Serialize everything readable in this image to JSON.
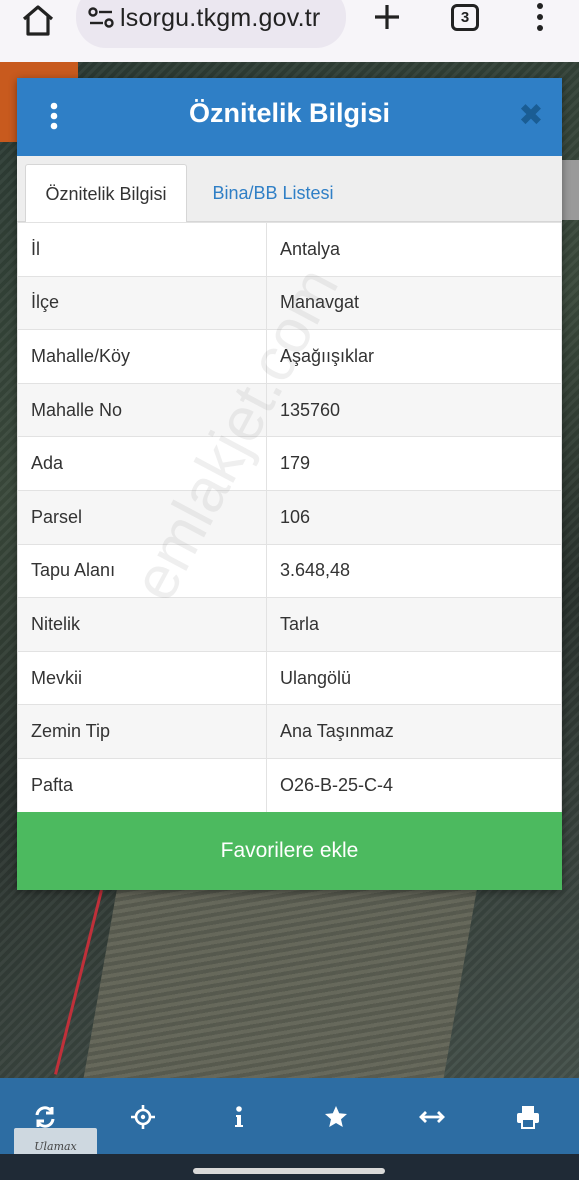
{
  "browser": {
    "url": "lsorgu.tkgm.gov.tr",
    "tab_count": "3",
    "icons": [
      "home-icon",
      "site-info-icon",
      "plus-icon",
      "tab-switcher-icon",
      "more-vertical-icon"
    ]
  },
  "dialog": {
    "title": "Öznitelik Bilgisi",
    "close_glyph": "✖",
    "tabs": [
      {
        "label": "Öznitelik Bilgisi",
        "active": true
      },
      {
        "label": "Bina/BB Listesi",
        "active": false
      }
    ],
    "rows": [
      {
        "key": "İl",
        "value": "Antalya"
      },
      {
        "key": "İlçe",
        "value": "Manavgat"
      },
      {
        "key": "Mahalle/Köy",
        "value": "Aşağıışıklar"
      },
      {
        "key": "Mahalle No",
        "value": "135760"
      },
      {
        "key": "Ada",
        "value": "179"
      },
      {
        "key": "Parsel",
        "value": "106"
      },
      {
        "key": "Tapu Alanı",
        "value": "3.648,48"
      },
      {
        "key": "Nitelik",
        "value": "Tarla"
      },
      {
        "key": "Mevkii",
        "value": "Ulangölü"
      },
      {
        "key": "Zemin Tip",
        "value": "Ana Taşınmaz"
      },
      {
        "key": "Pafta",
        "value": "O26-B-25-C-4"
      }
    ],
    "favorite_button": "Favorilere ekle"
  },
  "watermark": "emlakjet.com",
  "logo_text": "Ulamax",
  "toolbar": {
    "icons": [
      "refresh-icon",
      "locate-icon",
      "info-icon",
      "star-icon",
      "measure-icon",
      "print-icon"
    ]
  },
  "colors": {
    "header_blue": "#2f7fc6",
    "toolbar_blue": "#2d6da3",
    "button_green": "#4cba5f"
  }
}
